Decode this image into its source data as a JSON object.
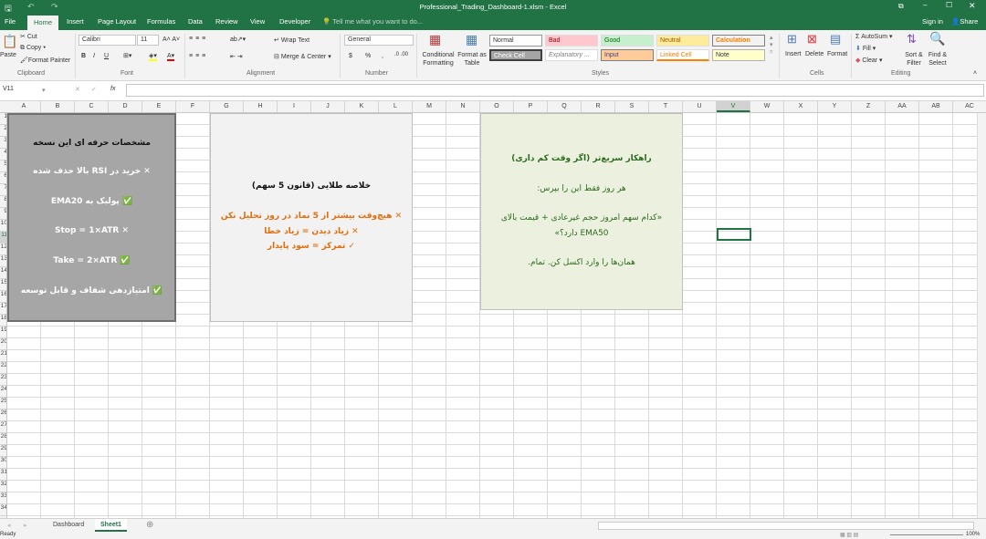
{
  "window": {
    "title": "Professional_Trading_Dashboard-1.xlsm - Excel",
    "sign_in": "Sign in",
    "share": "Share"
  },
  "tabs": [
    "File",
    "Home",
    "Insert",
    "Page Layout",
    "Formulas",
    "Data",
    "Review",
    "View",
    "Developer"
  ],
  "tell_me": "Tell me what you want to do...",
  "ribbon": {
    "clipboard": {
      "paste": "Paste",
      "cut": "Cut",
      "copy": "Copy",
      "format_painter": "Format Painter",
      "label": "Clipboard"
    },
    "font": {
      "name": "Calibri",
      "size": "11",
      "bold": "B",
      "italic": "I",
      "underline": "U",
      "label": "Font"
    },
    "alignment": {
      "wrap": "Wrap Text",
      "merge": "Merge & Center",
      "label": "Alignment"
    },
    "number": {
      "format": "General",
      "currency": "$",
      "percent": "%",
      "comma": ",",
      "label": "Number"
    },
    "styles": {
      "conditional": "Conditional Formatting",
      "format_table": "Format as Table",
      "items": [
        "Normal",
        "Bad",
        "Good",
        "Neutral",
        "Calculation",
        "Check Cell",
        "Explanatory ...",
        "Input",
        "Linked Cell",
        "Note"
      ],
      "label": "Styles"
    },
    "cells": {
      "insert": "Insert",
      "delete": "Delete",
      "format": "Format",
      "label": "Cells"
    },
    "editing": {
      "autosum": "AutoSum",
      "fill": "Fill",
      "clear": "Clear",
      "sort": "Sort & Filter",
      "find": "Find & Select",
      "label": "Editing"
    }
  },
  "formula_bar": {
    "name_box": "V11",
    "fx": "fx",
    "value": ""
  },
  "columns": [
    "A",
    "B",
    "C",
    "D",
    "E",
    "F",
    "G",
    "H",
    "I",
    "J",
    "K",
    "L",
    "M",
    "N",
    "O",
    "P",
    "Q",
    "R",
    "S",
    "T",
    "U",
    "V",
    "W",
    "X",
    "Y",
    "Z",
    "AA",
    "AB",
    "AC"
  ],
  "rows": [
    "1",
    "2",
    "3",
    "4",
    "5",
    "6",
    "7",
    "8",
    "9",
    "10",
    "11",
    "12",
    "13",
    "14",
    "15",
    "16",
    "17",
    "18",
    "19",
    "20",
    "21",
    "22",
    "23",
    "24",
    "25",
    "26",
    "27",
    "28",
    "29",
    "30",
    "31",
    "32",
    "33",
    "34"
  ],
  "box1": {
    "title": "مشخصات حرفه ای این نسخه",
    "lines": [
      "✕ خرید در RSI بالا حذف شده",
      "✅ پولبک به EMA20",
      "Stop = 1×ATR ✕",
      "Take = 2×ATR ✅",
      "✅ امتیازدهی شفاف و قابل توسعه"
    ]
  },
  "box2": {
    "title": "خلاصه طلایی (قانون 5 سهم)",
    "lines": [
      "✕ هیچ‌وقت بیشتر از 5 نماد در روز تحلیل نکن",
      "✕ زیاد دیدن = زیاد خطا",
      "✓ تمرکز = سود پایدار"
    ]
  },
  "box3": {
    "title": "راهکار سریع‌تر (اگر وقت کم داری)",
    "line1": "هر روز فقط این را بپرس:",
    "line2": "«کدام سهم امروز حجم غیرعادی + قیمت بالای",
    "line3": "EMA50 دارد؟»",
    "line4": "همان‌ها را وارد اکسل کن. تمام."
  },
  "sheets": [
    "Dashboard",
    "Sheet1"
  ],
  "status": {
    "ready": "Ready",
    "zoom": "100%"
  },
  "colors": {
    "excel_green": "#217346",
    "box1": "#a6a6a6",
    "box2": "#f2f2f2",
    "box3": "#ebf1de",
    "orange": "#e46c0a",
    "green_text": "#2d6a1f"
  }
}
